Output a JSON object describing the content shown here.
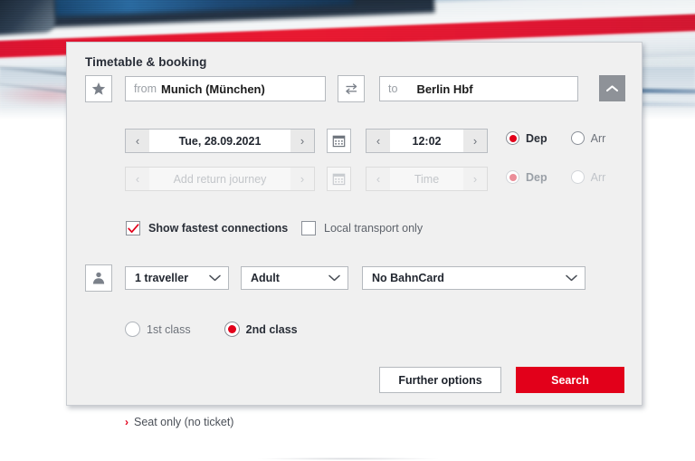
{
  "panel": {
    "title": "Timetable & booking",
    "favourite_icon": "star-icon",
    "swap_icon": "swap-arrows-icon",
    "collapse_icon": "chevron-up-icon",
    "traveller_icon": "person-icon",
    "calendar_icon": "calendar-icon",
    "accent_color": "#e2001a",
    "background_color": "#f0f0f0"
  },
  "origin": {
    "label": "from",
    "value": "Munich (München)",
    "placeholder": "from"
  },
  "destination": {
    "label": "to",
    "value": "Berlin Hbf",
    "placeholder": "to"
  },
  "outbound": {
    "date": "Tue, 28.09.2021",
    "time": "12:02",
    "prev_arrow": "‹",
    "next_arrow": "›",
    "dep_label": "Dep",
    "arr_label": "Arr",
    "selected": "Dep"
  },
  "return": {
    "date_placeholder": "Add return journey",
    "time_placeholder": "Time",
    "prev_arrow": "‹",
    "next_arrow": "›",
    "dep_label": "Dep",
    "arr_label": "Arr",
    "selected": "Dep"
  },
  "options": {
    "fastest": {
      "label": "Show fastest connections",
      "checked": true
    },
    "local": {
      "label": "Local transport only",
      "checked": false
    }
  },
  "travellers": {
    "count": "1 traveller",
    "type": "Adult",
    "bahncard": "No BahnCard",
    "chevron": "⌄"
  },
  "travel_class": {
    "first": "1st class",
    "second": "2nd class",
    "selected": "2nd class"
  },
  "actions": {
    "seat_only": "Seat only (no ticket)",
    "seat_only_chevron": "›",
    "further_options": "Further options",
    "search": "Search"
  }
}
